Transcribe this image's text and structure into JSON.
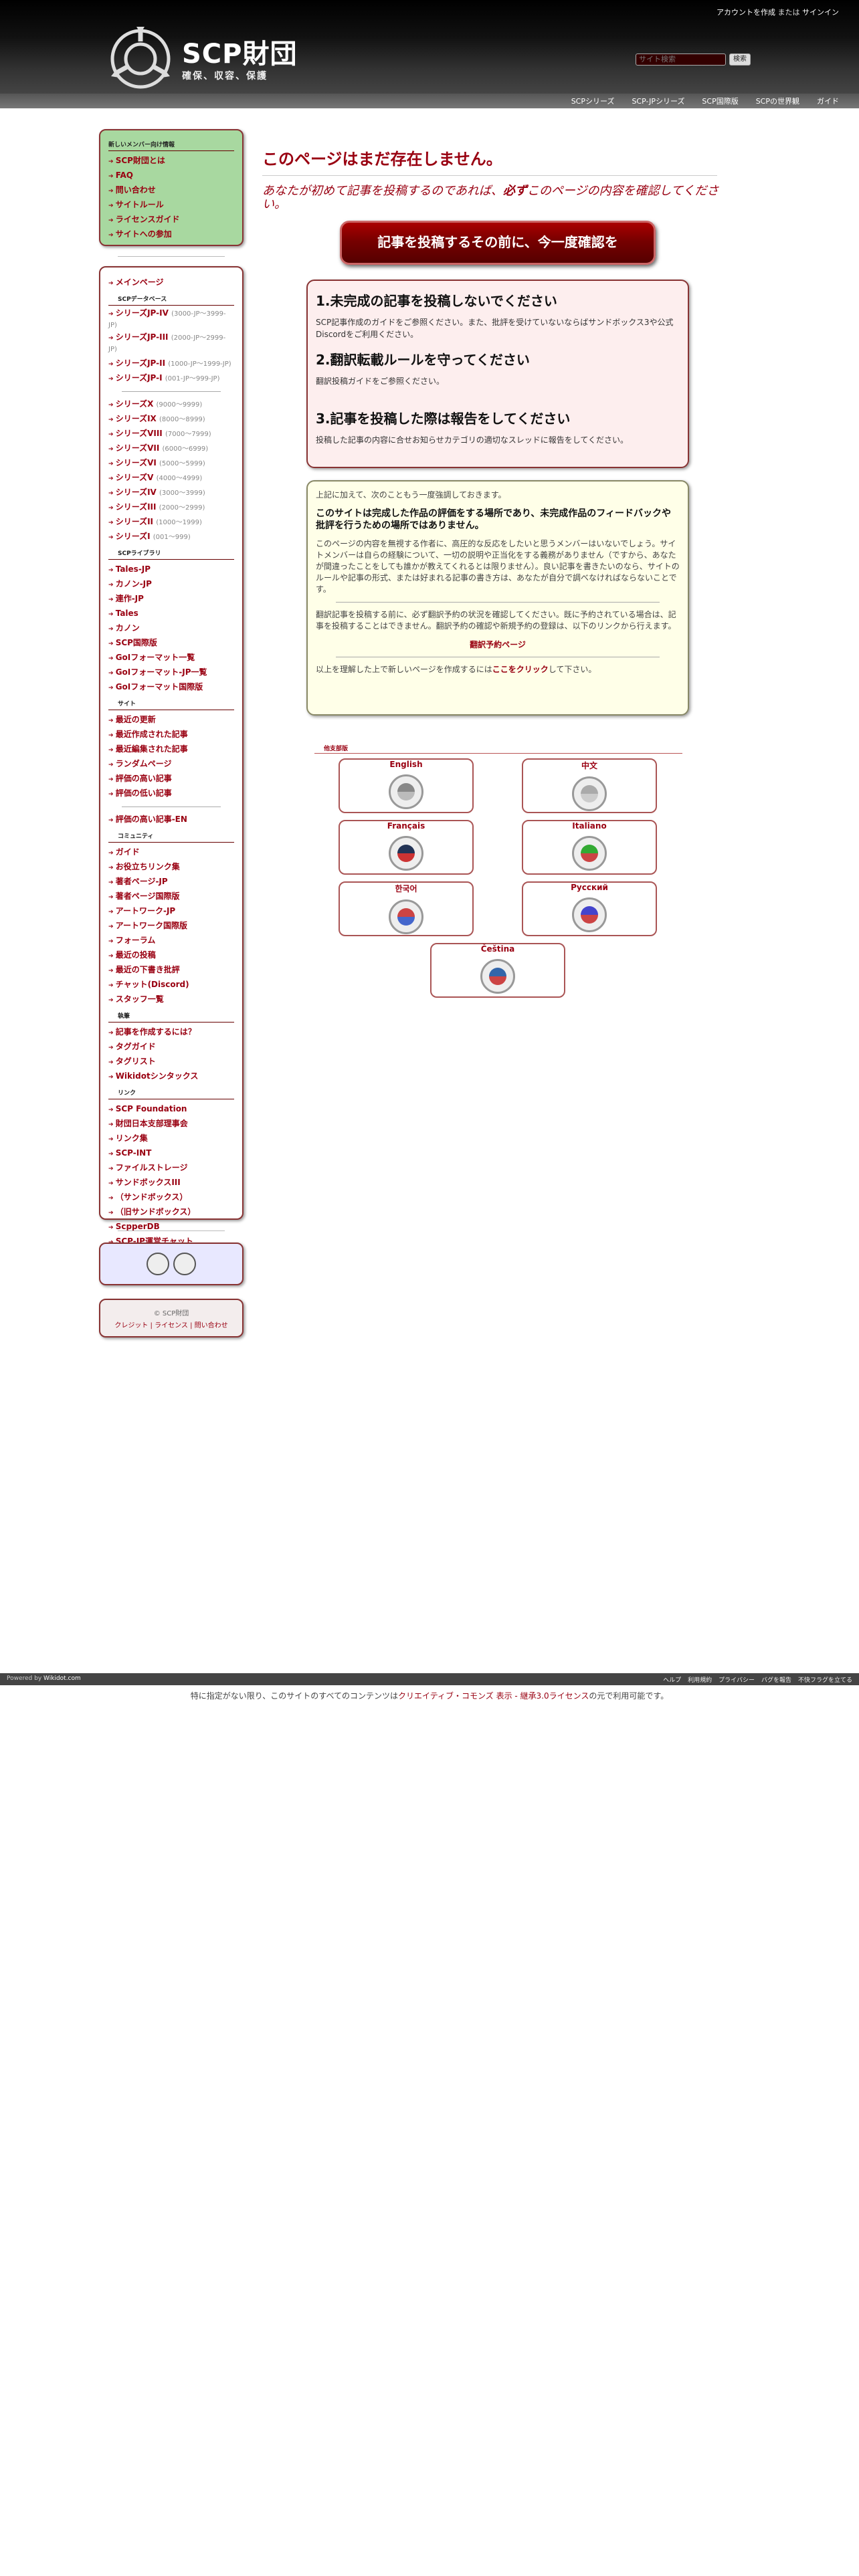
{
  "header": {
    "account_prefix": "アカウントを作成",
    "account_mid": " または ",
    "account_signin": "サインイン",
    "title": "SCP財団",
    "subtitle": "確保、収容、保護",
    "search_placeholder": "サイト検索",
    "search_button": "検索",
    "nav": [
      "SCPシリーズ",
      "SCP-JPシリーズ",
      "SCP国際版",
      "SCPの世界観",
      "ガイド"
    ]
  },
  "sidebar": {
    "new_heading": "新しいメンバー向け情報",
    "new_items": [
      "SCP財団とは",
      "FAQ",
      "問い合わせ",
      "サイトルール",
      "ライセンスガイド",
      "サイトへの参加"
    ],
    "menu": [
      {
        "type": "item",
        "label": "メインページ",
        "range": ""
      },
      {
        "type": "sub",
        "label": "SCPデータベース"
      },
      {
        "type": "wrap",
        "label": "シリーズJP-IV",
        "range": "(3000-JP〜3999-JP)"
      },
      {
        "type": "wrap",
        "label": "シリーズJP-III",
        "range": "(2000-JP〜2999-JP)"
      },
      {
        "type": "item",
        "label": "シリーズJP-II",
        "range": "(1000-JP〜1999-JP)"
      },
      {
        "type": "item",
        "label": "シリーズJP-I",
        "range": "(001-JP〜999-JP)"
      },
      {
        "type": "sep"
      },
      {
        "type": "item",
        "label": "シリーズX",
        "range": "(9000〜9999)"
      },
      {
        "type": "item",
        "label": "シリーズIX",
        "range": "(8000〜8999)"
      },
      {
        "type": "item",
        "label": "シリーズVIII",
        "range": "(7000〜7999)"
      },
      {
        "type": "item",
        "label": "シリーズVII",
        "range": "(6000〜6999)"
      },
      {
        "type": "item",
        "label": "シリーズVI",
        "range": "(5000〜5999)"
      },
      {
        "type": "item",
        "label": "シリーズV",
        "range": "(4000〜4999)"
      },
      {
        "type": "item",
        "label": "シリーズIV",
        "range": "(3000〜3999)"
      },
      {
        "type": "item",
        "label": "シリーズIII",
        "range": "(2000〜2999)"
      },
      {
        "type": "item",
        "label": "シリーズII",
        "range": "(1000〜1999)"
      },
      {
        "type": "item",
        "label": "シリーズI",
        "range": "(001〜999)"
      },
      {
        "type": "sub",
        "label": "SCPライブラリ"
      },
      {
        "type": "item",
        "label": "Tales-JP",
        "range": ""
      },
      {
        "type": "item",
        "label": "カノン-JP",
        "range": ""
      },
      {
        "type": "item",
        "label": "連作-JP",
        "range": ""
      },
      {
        "type": "item",
        "label": "Tales",
        "range": ""
      },
      {
        "type": "item",
        "label": "カノン",
        "range": ""
      },
      {
        "type": "item",
        "label": "SCP国際版",
        "range": ""
      },
      {
        "type": "item",
        "label": "GoIフォーマット一覧",
        "range": ""
      },
      {
        "type": "item",
        "label": "GoIフォーマット-JP一覧",
        "range": ""
      },
      {
        "type": "item",
        "label": "GoIフォーマット国際版",
        "range": ""
      },
      {
        "type": "sub",
        "label": "サイト"
      },
      {
        "type": "item",
        "label": "最近の更新",
        "range": ""
      },
      {
        "type": "item",
        "label": "最近作成された記事",
        "range": ""
      },
      {
        "type": "item",
        "label": "最近編集された記事",
        "range": ""
      },
      {
        "type": "item",
        "label": "ランダムページ",
        "range": ""
      },
      {
        "type": "item",
        "label": "評価の高い記事",
        "range": ""
      },
      {
        "type": "item",
        "label": "評価の低い記事",
        "range": ""
      },
      {
        "type": "sep"
      },
      {
        "type": "item",
        "label": "評価の高い記事-EN",
        "range": ""
      },
      {
        "type": "sub",
        "label": "コミュニティ"
      },
      {
        "type": "item",
        "label": "ガイド",
        "range": ""
      },
      {
        "type": "item",
        "label": "お役立ちリンク集",
        "range": ""
      },
      {
        "type": "item",
        "label": "著者ページ-JP",
        "range": ""
      },
      {
        "type": "item",
        "label": "著者ページ国際版",
        "range": ""
      },
      {
        "type": "item",
        "label": "アートワーク-JP",
        "range": ""
      },
      {
        "type": "item",
        "label": "アートワーク国際版",
        "range": ""
      },
      {
        "type": "item",
        "label": "フォーラム",
        "range": ""
      },
      {
        "type": "item",
        "label": "最近の投稿",
        "range": ""
      },
      {
        "type": "item",
        "label": "最近の下書き批評",
        "range": ""
      },
      {
        "type": "item",
        "label": "チャット(Discord)",
        "range": ""
      },
      {
        "type": "item",
        "label": "スタッフ一覧",
        "range": ""
      },
      {
        "type": "sub",
        "label": "執筆"
      },
      {
        "type": "item",
        "label": "記事を作成するには？",
        "range": ""
      },
      {
        "type": "item",
        "label": "タグガイド",
        "range": ""
      },
      {
        "type": "item",
        "label": "タグリスト",
        "range": ""
      },
      {
        "type": "item",
        "label": "Wikidotシンタックス",
        "range": ""
      },
      {
        "type": "sub",
        "label": "リンク"
      },
      {
        "type": "item",
        "label": "SCP Foundation",
        "range": ""
      },
      {
        "type": "item",
        "label": "財団日本支部理事会",
        "range": ""
      },
      {
        "type": "item",
        "label": "リンク集",
        "range": ""
      },
      {
        "type": "item",
        "label": "SCP-INT",
        "range": ""
      },
      {
        "type": "item",
        "label": "ファイルストレージ",
        "range": ""
      },
      {
        "type": "item",
        "label": "サンドボックスIII",
        "range": ""
      },
      {
        "type": "item",
        "label": "（サンドボックス）",
        "range": ""
      },
      {
        "type": "item",
        "label": "（旧サンドボックス）",
        "range": ""
      },
      {
        "type": "item",
        "label": "ScpperDB",
        "range": ""
      },
      {
        "type": "item",
        "label": "SCP-JP運営チャット",
        "range": ""
      }
    ],
    "copyright": "© SCP財団",
    "copy_links": "クレジット | ライセンス | 問い合わせ"
  },
  "main": {
    "title": "このページはまだ存在しません。",
    "intro_pre": "あなたが初めて記事を投稿するのであれば、",
    "intro_bold": "必ず",
    "intro_post": "このページの内容を確認してください。",
    "big_button": "記事を投稿するその前に、今一度確認を",
    "rules": [
      {
        "heading": "1.未完成の記事を投稿しないでください",
        "text": "SCP記事作成のガイドをご参照ください。また、批評を受けていないならばサンドボックス3や公式Discordをご利用ください。"
      },
      {
        "heading": "2.翻訳転載ルールを守ってください",
        "text": "翻訳投稿ガイドをご参照ください。"
      },
      {
        "heading": "3.記事を投稿した際は報告をしてください",
        "text": "投稿した記事の内容に合せお知らせカテゴリの適切なスレッドに報告をしてください。"
      }
    ],
    "note_intro": "上記に加えて、次のこともう一度強調しておきます。",
    "note_heading": "このサイトは完成した作品の評価をする場所であり、未完成作品のフィードバックや批評を行うための場所ではありません。",
    "note_body": "このページの内容を無視する作者に、高圧的な反応をしたいと思うメンバーはいないでしょう。サイトメンバーは自らの経験について、一切の説明や正当化をする義務がありません（ですから、あなたが間違ったことをしても誰かが教えてくれるとは限りません）。良い記事を書きたいのなら、サイトのルールや記事の形式、または好まれる記事の書き方は、あなたが自分で調べなければならないことです。",
    "note_translate": "翻訳記事を投稿する前に、必ず翻訳予約の状況を確認してください。既に予約されている場合は、記事を投稿することはできません。翻訳予約の確認や新規予約の登録は、以下のリンクから行えます。",
    "note_reserve": "翻訳予約ページ",
    "note_final_pre": "以上を理解した上で新しいページを作成するには",
    "note_final_link": "ここをクリック",
    "note_final_post": "して下さい。",
    "branch_label": "他支部版",
    "branches": [
      "English",
      "中文",
      "Français",
      "Italiano",
      "한국어",
      "Русский",
      "Čeština"
    ]
  },
  "footer": {
    "powered_pre": "Powered by ",
    "powered_link": "Wikidot.com",
    "links": [
      "ヘルプ",
      "利用規約",
      "プライバシー",
      "バグを報告",
      "不快フラグを立てる"
    ],
    "license_pre": "特に指定がない限り、このサイトのすべてのコンテンツは",
    "license_link": "クリエイティブ・コモンズ 表示 - 継承3.0ライセンス",
    "license_post": "の元で利用可能です。"
  },
  "colors": {
    "accent": "#990011",
    "sidebar_green": "#a8d8a0",
    "rules_bg": "#fdeeee",
    "note_bg": "#ffffe8"
  },
  "icons": [
    "scp-logo-icon",
    "arrow-bullet-icon",
    "branch-logo-icon"
  ]
}
